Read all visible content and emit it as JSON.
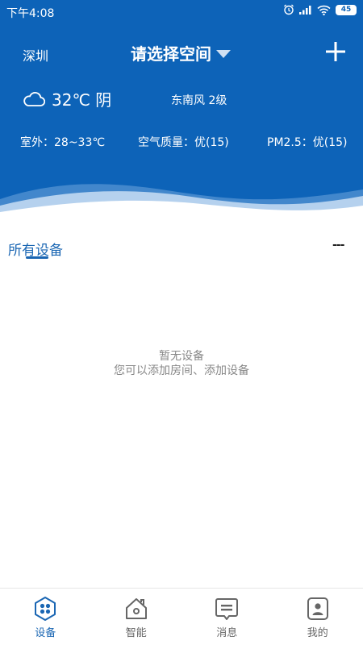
{
  "status_bar": {
    "time": "下午4:08",
    "battery": "45",
    "icons": [
      "alarm-icon",
      "signal-icon",
      "wifi-icon",
      "battery-icon"
    ]
  },
  "header": {
    "city": "深圳",
    "space_select": "请选择空间",
    "add_icon": "plus-icon"
  },
  "weather": {
    "icon": "cloud-icon",
    "temp_condition": "32℃ 阴",
    "wind": "东南风 2级",
    "outdoor": "室外：28~33℃",
    "air_quality": "空气质量：优(15)",
    "pm25": "PM2.5：优(15)"
  },
  "section": {
    "title": "所有设备",
    "more": "---"
  },
  "empty_state": {
    "line1": "暂无设备",
    "line2": "您可以添加房间、添加设备"
  },
  "tabs": [
    {
      "label": "设备",
      "icon": "devices-icon",
      "active": true
    },
    {
      "label": "智能",
      "icon": "smart-home-icon",
      "active": false
    },
    {
      "label": "消息",
      "icon": "message-icon",
      "active": false
    },
    {
      "label": "我的",
      "icon": "profile-icon",
      "active": false
    }
  ],
  "colors": {
    "header_bg": "#0d63b8",
    "accent": "#1a66b3"
  }
}
